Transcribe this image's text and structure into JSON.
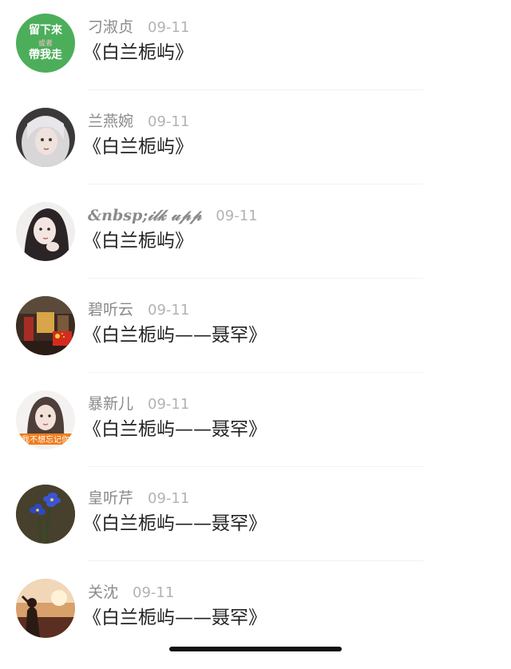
{
  "comments": [
    {
      "user": "刁淑贞",
      "date": "09-11",
      "title": "《白兰栀屿》",
      "avatar": {
        "kind": "green-badge",
        "line1": "留下來",
        "line2": "或者",
        "line3": "帶我走"
      }
    },
    {
      "user": "兰燕婉",
      "date": "09-11",
      "title": "《白兰栀屿》",
      "avatar": {
        "kind": "photo-girl-silver-hair"
      }
    },
    {
      "user": "&nbsp;𝒾𝓁𝓀 𝓊𝓅𝓅",
      "date": "09-11",
      "title": "《白兰栀屿》",
      "avatar": {
        "kind": "photo-girl-dark-hair"
      }
    },
    {
      "user": "碧听云",
      "date": "09-11",
      "title": "《白兰栀屿——聂罕》",
      "avatar": {
        "kind": "photo-street-flag"
      }
    },
    {
      "user": "暴新儿",
      "date": "09-11",
      "title": "《白兰栀屿——聂罕》",
      "avatar": {
        "kind": "photo-girl-banner",
        "banner_text": "我不想忘记你"
      }
    },
    {
      "user": "皇听芹",
      "date": "09-11",
      "title": "《白兰栀屿——聂罕》",
      "avatar": {
        "kind": "photo-blue-flowers"
      }
    },
    {
      "user": "关沈",
      "date": "09-11",
      "title": "《白兰栀屿——聂罕》",
      "avatar": {
        "kind": "photo-sunset-figure"
      }
    }
  ]
}
